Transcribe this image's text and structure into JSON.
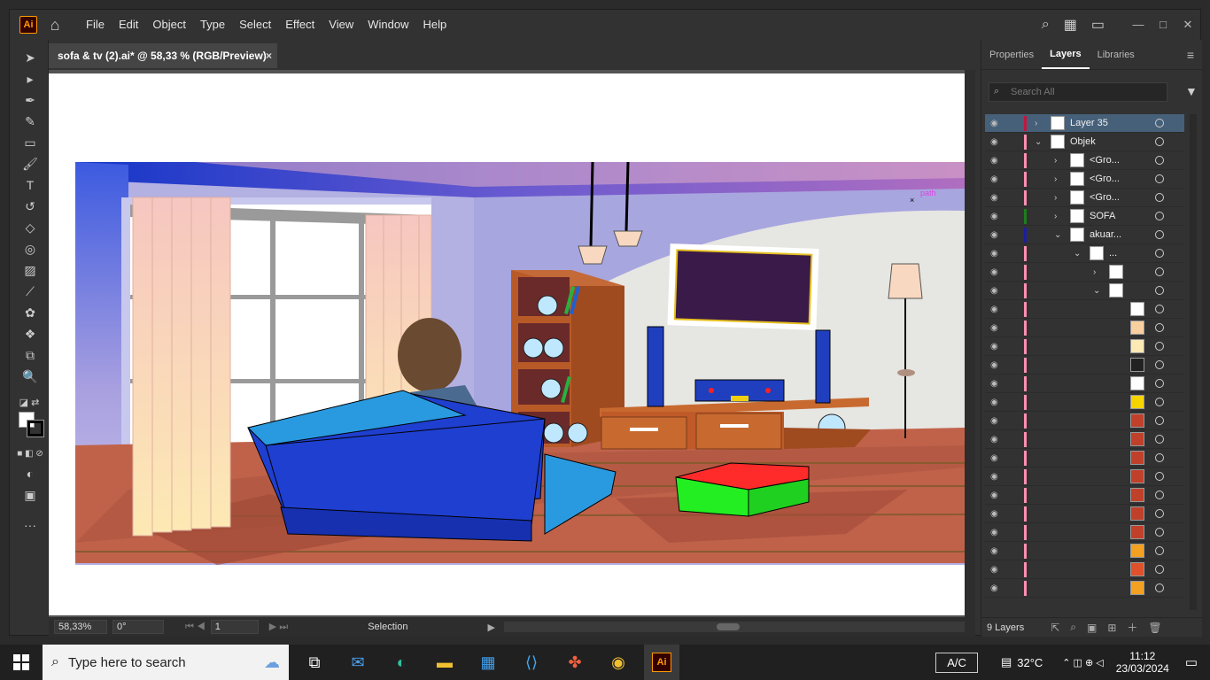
{
  "app": {
    "logo": "Ai",
    "menu": [
      "File",
      "Edit",
      "Object",
      "Type",
      "Select",
      "Effect",
      "View",
      "Window",
      "Help"
    ],
    "doc_tab": "sofa & tv (2).ai* @ 58,33 % (RGB/Preview)",
    "close_glyph": "×"
  },
  "canvas": {
    "path_label": "path"
  },
  "status": {
    "zoom": "58,33%",
    "rotate": "0°",
    "artboard": "1",
    "tool": "Selection"
  },
  "panel": {
    "tabs": [
      "Properties",
      "Layers",
      "Libraries"
    ],
    "active_tab": "Layers",
    "search_placeholder": "Search All",
    "layers": [
      {
        "name": "Layer 35",
        "color": "#c0183e",
        "selected": true
      },
      {
        "name": "Objek",
        "color": "#ff8fb0"
      },
      {
        "name": "<Gro...",
        "color": "#ff8fb0"
      },
      {
        "name": "<Gro...",
        "color": "#ff8fb0"
      },
      {
        "name": "<Gro...",
        "color": "#ff8fb0"
      },
      {
        "name": "SOFA",
        "color": "#1e7d1e"
      },
      {
        "name": "akuar...",
        "color": "#1e1e9e"
      },
      {
        "name": "...",
        "color": "#ff8fb0"
      },
      {
        "name": "",
        "color": "#ff8fb0"
      },
      {
        "name": "",
        "color": "#ff8fb0"
      }
    ],
    "count": "9 Layers"
  },
  "taskbar": {
    "search_text": "Type here to search",
    "ac": "A/C",
    "temp": "32°C",
    "time": "11:12",
    "date": "23/03/2024"
  },
  "colors": {
    "accent": "#ff9a00",
    "sofa": "#1f3fd0",
    "ottoman_top": "#ff2a2a",
    "ottoman_side": "#22ee22"
  }
}
